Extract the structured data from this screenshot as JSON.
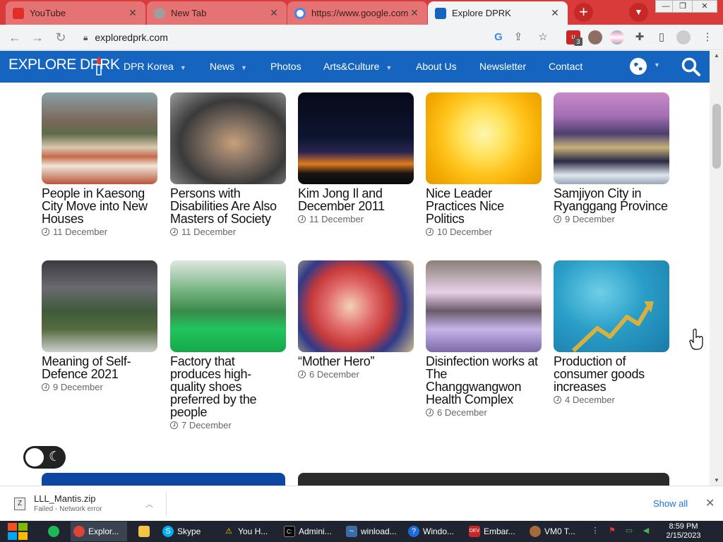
{
  "browser": {
    "tabs": [
      {
        "title": "YouTube",
        "icon": "youtube-icon"
      },
      {
        "title": "New Tab",
        "icon": "chrome-icon"
      },
      {
        "title": "https://www.google.com",
        "icon": "google-icon"
      },
      {
        "title": "Explore DPRK",
        "icon": "explore-dprk-icon"
      }
    ],
    "url": "exploredprk.com",
    "extension_badge": "3"
  },
  "site": {
    "logo": "EXPLORE DPRK",
    "nav": [
      {
        "label": "DPR Korea",
        "has_dropdown": true
      },
      {
        "label": "News",
        "has_dropdown": true
      },
      {
        "label": "Photos",
        "has_dropdown": false
      },
      {
        "label": "Arts&Culture",
        "has_dropdown": true
      },
      {
        "label": "About Us",
        "has_dropdown": false
      },
      {
        "label": "Newsletter",
        "has_dropdown": false
      },
      {
        "label": "Contact",
        "has_dropdown": false
      }
    ],
    "accent": "#1565c0"
  },
  "articles": [
    {
      "title": "People in Kaesong City Move into New Houses",
      "date": "11 December"
    },
    {
      "title": "Persons with Disabilities Are Also Masters of Society",
      "date": "11 December"
    },
    {
      "title": "Kim Jong Il and December 2011",
      "date": "11 December"
    },
    {
      "title": "Nice Leader Practices Nice Politics",
      "date": "10 December"
    },
    {
      "title": "Samjiyon City in Ryanggang Province",
      "date": "9 December"
    },
    {
      "title": "Meaning of Self-Defence 2021",
      "date": "9 December"
    },
    {
      "title": "Factory that produces high-quality shoes preferred by the people",
      "date": "7 December"
    },
    {
      "title": "“Mother Hero”",
      "date": "6 December"
    },
    {
      "title": "Disinfection works at The Changgwangwon Health Complex",
      "date": "6 December"
    },
    {
      "title": "Production of consumer goods increases",
      "date": "4 December"
    }
  ],
  "download": {
    "filename": "LLL_Mantis.zip",
    "status": "Failed - Network error",
    "show_all": "Show all"
  },
  "taskbar": {
    "items": [
      {
        "label": "",
        "icon": "spotify-icon"
      },
      {
        "label": "Explor...",
        "icon": "chrome-icon",
        "active": true
      },
      {
        "label": "",
        "icon": "folder-icon"
      },
      {
        "label": "Skype",
        "icon": "skype-icon"
      },
      {
        "label": "You H...",
        "icon": "warning-icon"
      },
      {
        "label": "Admini...",
        "icon": "cmd-icon"
      },
      {
        "label": "winload...",
        "icon": "winload-icon"
      },
      {
        "label": "Windo...",
        "icon": "help-icon"
      },
      {
        "label": "Embar...",
        "icon": "dev-icon"
      },
      {
        "label": "VM0 T...",
        "icon": "vm-icon"
      }
    ],
    "time": "8:59 PM",
    "date": "2/15/2023"
  }
}
